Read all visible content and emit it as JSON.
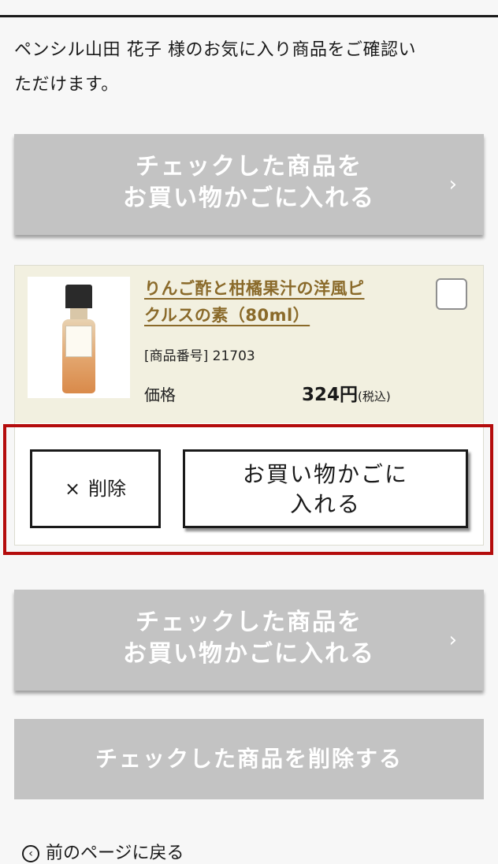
{
  "intro": {
    "line1": "ペンシル山田 花子 様のお気に入り商品をご確認い",
    "line2": "ただけます。"
  },
  "bulk_add_top": {
    "line1": "チェックした商品を",
    "line2": "お買い物かごに入れる",
    "chevron": "›"
  },
  "product": {
    "name_line1": "りんご酢と柑橘果汁の洋風ピ",
    "name_line2": "クルスの素（80ml）",
    "sku": "[商品番号] 21703",
    "price_label": "価格",
    "price": "324円",
    "tax": "(税込)",
    "delete_icon": "×",
    "delete_label": "削除",
    "add_to_cart_line1": "お買い物かごに",
    "add_to_cart_line2": "入れる"
  },
  "bulk_add_bottom": {
    "line1": "チェックした商品を",
    "line2": "お買い物かごに入れる",
    "chevron": "›"
  },
  "bulk_delete": {
    "label": "チェックした商品を削除する"
  },
  "back_link": {
    "icon": "‹",
    "label": "前のページに戻る"
  },
  "colors": {
    "highlight_border": "#b40c0c",
    "gray_button": "#c3c3c3",
    "product_link": "#8a6a2a",
    "card_background": "#f2f0e0"
  }
}
